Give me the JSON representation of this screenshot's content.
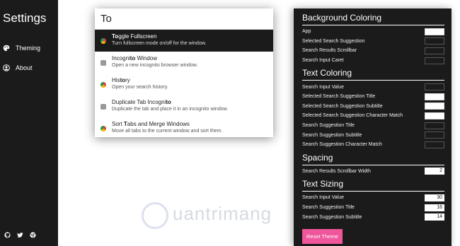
{
  "sidebar": {
    "title": "Settings",
    "items": [
      {
        "label": "Theming"
      },
      {
        "label": "About"
      }
    ],
    "footer_icons": [
      "github-icon",
      "twitter-icon",
      "chrome-icon"
    ]
  },
  "popup": {
    "query": "To",
    "results": [
      {
        "title_pre": "",
        "title_bold": "To",
        "title_post": "ggle Fullscreen",
        "subtitle": "Turn fullscreen mode on/off for the window."
      },
      {
        "title_pre": "Incogni",
        "title_bold": "to",
        "title_post": " Window",
        "subtitle": "Open a new incognito browser window."
      },
      {
        "title_pre": "His",
        "title_bold": "to",
        "title_post": "ry",
        "subtitle": "Open your search history."
      },
      {
        "title_pre": "Duplicate Tab Incogni",
        "title_bold": "to",
        "title_post": "",
        "subtitle": "Duplicate the tab and place it in an incognito window."
      },
      {
        "title_pre": "Sort ",
        "title_bold": "T",
        "title_post": "abs and Merge Windows",
        "subtitle": "Move all tabs to the current window and sort them."
      }
    ]
  },
  "panel": {
    "background_coloring": {
      "title": "Background Coloring",
      "rows": [
        {
          "label": "App",
          "swatch": "#ffffff"
        },
        {
          "label": "Selected Search Suggestion",
          "swatch": "#1b1b1b"
        },
        {
          "label": "Search Results Scrollbar",
          "swatch": "#1b1b1b"
        },
        {
          "label": "Search Input Caret",
          "swatch": "#1b1b1b"
        }
      ]
    },
    "text_coloring": {
      "title": "Text Coloring",
      "rows": [
        {
          "label": "Search Input Value",
          "swatch": "#1b1b1b"
        },
        {
          "label": "Selected Search Suggestion Title",
          "swatch": "#ffffff"
        },
        {
          "label": "Selected Search Suggestion Subtitle",
          "swatch": "#ffffff"
        },
        {
          "label": "Selected Search Suggestion Character Match",
          "swatch": "#ffffff"
        },
        {
          "label": "Search Suggestion Title",
          "swatch": "#1b1b1b"
        },
        {
          "label": "Search Suggestion Subtitle",
          "swatch": "#1b1b1b"
        },
        {
          "label": "Search Suggestion Character Match",
          "swatch": "#1b1b1b"
        }
      ]
    },
    "spacing": {
      "title": "Spacing",
      "rows": [
        {
          "label": "Search Results Scrollbar Width",
          "value": "2"
        }
      ]
    },
    "text_sizing": {
      "title": "Text Sizing",
      "rows": [
        {
          "label": "Search Input Value",
          "value": "30"
        },
        {
          "label": "Search Suggestion Title",
          "value": "16"
        },
        {
          "label": "Search Suggestion Subtitle",
          "value": "14"
        }
      ]
    },
    "reset_label": "Reset Theme",
    "accent": "#f0569b"
  }
}
